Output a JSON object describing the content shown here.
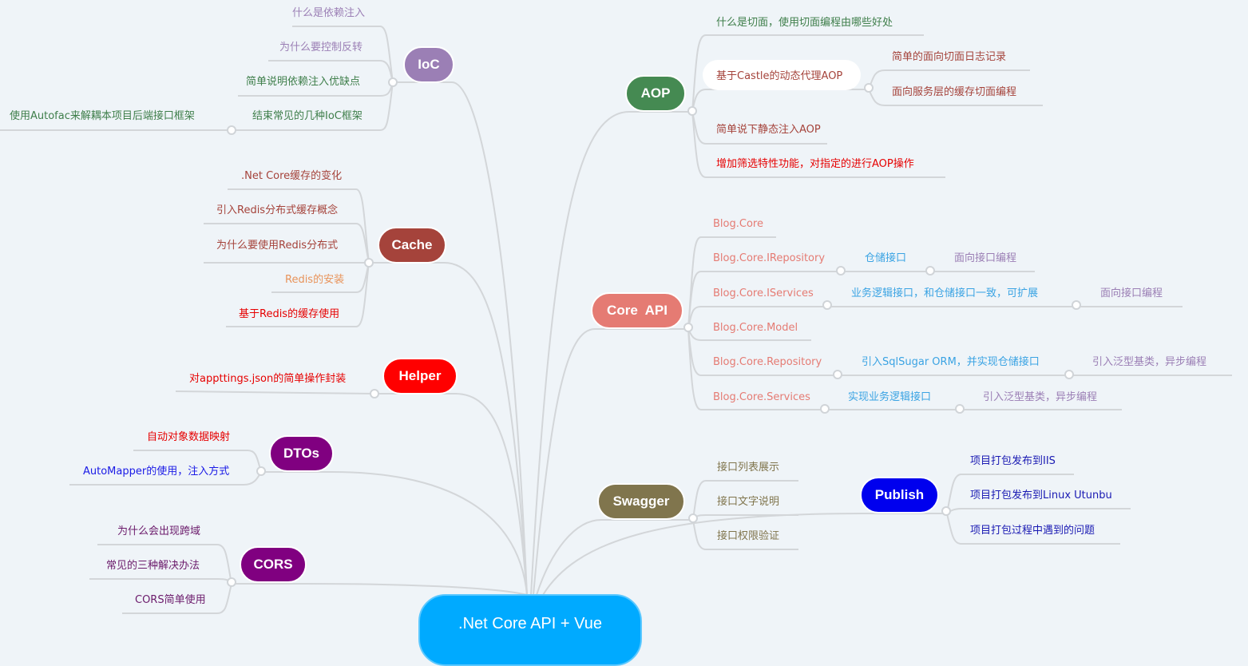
{
  "center": {
    "label": ".Net Core API + Vue",
    "color": "#00aaff"
  },
  "line_color": "#d3d6d9",
  "branches": {
    "ioc": {
      "label": "IoC",
      "color": "#9b7fb5",
      "children": [
        {
          "label": "什么是依赖注入",
          "color": "#9b7fb5"
        },
        {
          "label": "为什么要控制反转",
          "color": "#9b7fb5"
        },
        {
          "label": "简单说明依赖注入优缺点",
          "color": "#3e7e4a"
        },
        {
          "label": "结束常见的几种IoC框架",
          "color": "#3e7e4a",
          "children": [
            {
              "label": "使用Autofac来解耦本项目后端接口框架",
              "color": "#3e7e4a"
            }
          ]
        }
      ]
    },
    "cache": {
      "label": "Cache",
      "color": "#a5433b",
      "children": [
        {
          "label": ".Net Core缓存的变化",
          "color": "#a5433b"
        },
        {
          "label": "引入Redis分布式缓存概念",
          "color": "#a5433b"
        },
        {
          "label": "为什么要使用Redis分布式",
          "color": "#a5433b"
        },
        {
          "label": "Redis的安装",
          "color": "#e8935a"
        },
        {
          "label": "基于Redis的缓存使用",
          "color": "#e60000"
        }
      ]
    },
    "helper": {
      "label": "Helper",
      "color": "#ff0000",
      "children": [
        {
          "label": "对appttings.json的简单操作封装",
          "color": "#e60000"
        }
      ]
    },
    "dtos": {
      "label": "DTOs",
      "color": "#800080",
      "children": [
        {
          "label": "自动对象数据映射",
          "color": "#e60000"
        },
        {
          "label": "AutoMapper的使用，注入方式",
          "color": "#1a1ae6"
        }
      ]
    },
    "cors": {
      "label": "CORS",
      "color": "#800080",
      "children": [
        {
          "label": "为什么会出现跨域",
          "color": "#6b1a6b"
        },
        {
          "label": "常见的三种解决办法",
          "color": "#6b1a6b"
        },
        {
          "label": "CORS简单使用",
          "color": "#6b1a6b"
        }
      ]
    },
    "aop": {
      "label": "AOP",
      "color": "#458a52",
      "children": [
        {
          "label": "什么是切面，使用切面编程由哪些好处",
          "color": "#3e7e4a"
        },
        {
          "label": "基于Castle的动态代理AOP",
          "color": "#a5433b",
          "children": [
            {
              "label": "简单的面向切面日志记录",
              "color": "#a5433b"
            },
            {
              "label": "面向服务层的缓存切面编程",
              "color": "#a5433b"
            }
          ]
        },
        {
          "label": "简单说下静态注入AOP",
          "color": "#a5433b"
        },
        {
          "label": "增加筛选特性功能，对指定的进行AOP操作",
          "color": "#e60000"
        }
      ]
    },
    "coreapi": {
      "label": "Core  API",
      "color": "#e57b73",
      "children": [
        {
          "label": "Blog.Core",
          "color": "#e57b73"
        },
        {
          "label": "Blog.Core.IRepository",
          "color": "#e57b73",
          "children": [
            {
              "label": "仓储接口",
              "color": "#3aa3e3",
              "children": [
                {
                  "label": "面向接口编程",
                  "color": "#9b7fb5"
                }
              ]
            }
          ]
        },
        {
          "label": "Blog.Core.IServices",
          "color": "#e57b73",
          "children": [
            {
              "label": "业务逻辑接口，和仓储接口一致，可扩展",
              "color": "#3aa3e3",
              "children": [
                {
                  "label": "面向接口编程",
                  "color": "#9b7fb5"
                }
              ]
            }
          ]
        },
        {
          "label": "Blog.Core.Model",
          "color": "#e57b73"
        },
        {
          "label": "Blog.Core.Repository",
          "color": "#e57b73",
          "children": [
            {
              "label": "引入SqlSugar ORM，并实现仓储接口",
              "color": "#3aa3e3",
              "children": [
                {
                  "label": "引入泛型基类，异步编程",
                  "color": "#9b7fb5"
                }
              ]
            }
          ]
        },
        {
          "label": "Blog.Core.Services",
          "color": "#e57b73",
          "children": [
            {
              "label": "实现业务逻辑接口",
              "color": "#3aa3e3",
              "children": [
                {
                  "label": "引入泛型基类，异步编程",
                  "color": "#9b7fb5"
                }
              ]
            }
          ]
        }
      ]
    },
    "swagger": {
      "label": "Swagger",
      "color": "#80754d",
      "children": [
        {
          "label": "接口列表展示",
          "color": "#80754d"
        },
        {
          "label": "接口文字说明",
          "color": "#80754d"
        },
        {
          "label": "接口权限验证",
          "color": "#80754d"
        }
      ]
    },
    "publish": {
      "label": "Publish",
      "color": "#0000ee",
      "children": [
        {
          "label": "项目打包发布到IIS",
          "color": "#1a1ab3"
        },
        {
          "label": "项目打包发布到Linux Utunbu",
          "color": "#1a1ab3"
        },
        {
          "label": "项目打包过程中遇到的问题",
          "color": "#1a1ab3"
        }
      ]
    }
  }
}
